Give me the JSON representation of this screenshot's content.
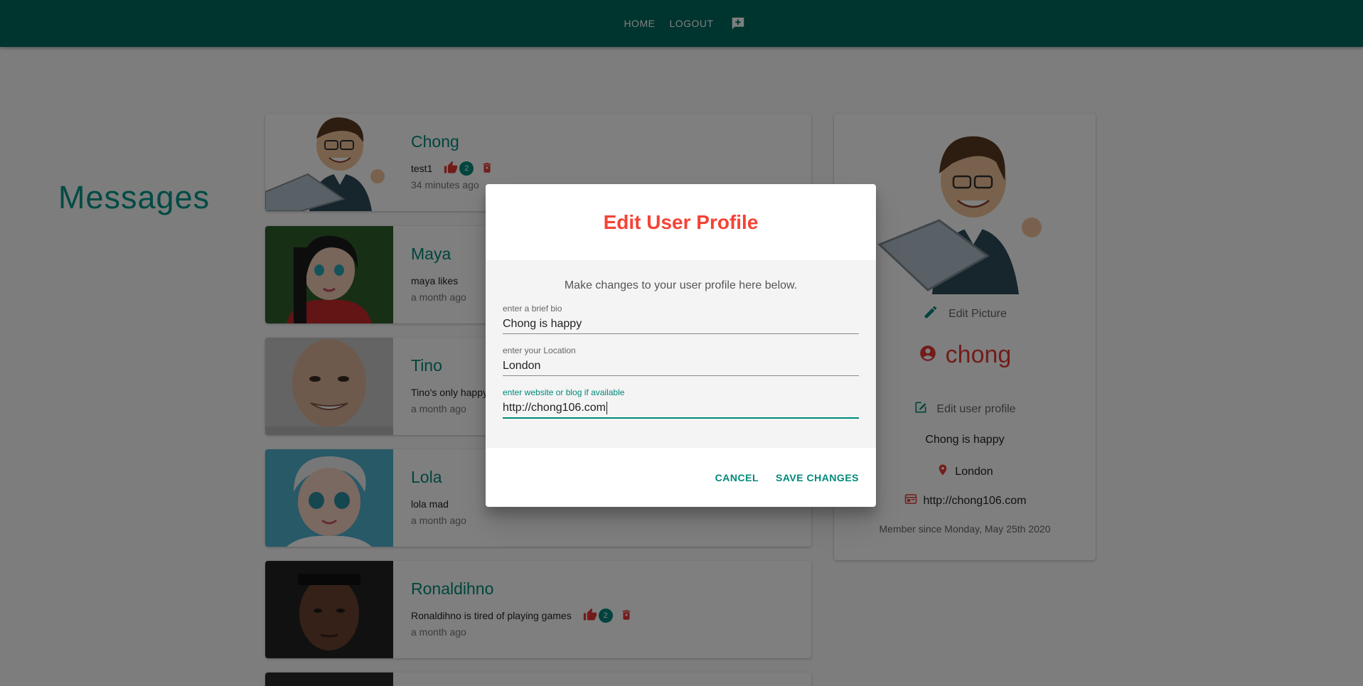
{
  "appbar": {
    "home": "HOME",
    "logout": "LOGOUT",
    "post_icon": "add-comment-icon"
  },
  "page": {
    "title": "Messages"
  },
  "messages": [
    {
      "name": "Chong",
      "body": "test1",
      "likes": "2",
      "time": "34 minutes ago",
      "avatar": "cartoon-man-laptop"
    },
    {
      "name": "Maya",
      "body": "maya likes",
      "likes": "",
      "time": "a month ago",
      "avatar": "cartoon-girl"
    },
    {
      "name": "Tino",
      "body": "Tino's only happy",
      "likes": "",
      "time": "a month ago",
      "avatar": "old-man-photo"
    },
    {
      "name": "Lola",
      "body": "lola mad",
      "likes": "",
      "time": "a month ago",
      "avatar": "cartoon-woman-white-hair"
    },
    {
      "name": "Ronaldihno",
      "body": "Ronaldihno is tired of playing games",
      "likes": "2",
      "time": "a month ago",
      "avatar": "man-headband-photo"
    }
  ],
  "profile": {
    "edit_picture": "Edit Picture",
    "username": "chong",
    "edit_profile": "Edit user profile",
    "bio": "Chong is happy",
    "location": "London",
    "website": "http://chong106.com",
    "member_since": "Member since Monday, May 25th 2020"
  },
  "dialog": {
    "title": "Edit User Profile",
    "text": "Make changes to your user profile here below.",
    "fields": [
      {
        "label": "enter a brief bio",
        "value": "Chong is happy"
      },
      {
        "label": "enter your Location",
        "value": "London"
      },
      {
        "label": "enter website or blog if available",
        "value": "http://chong106.com"
      }
    ],
    "cancel": "CANCEL",
    "save": "SAVE CHANGES"
  },
  "colors": {
    "primary": "#00695c",
    "accent": "#009688",
    "danger": "#f44336",
    "like": "#e53935"
  }
}
